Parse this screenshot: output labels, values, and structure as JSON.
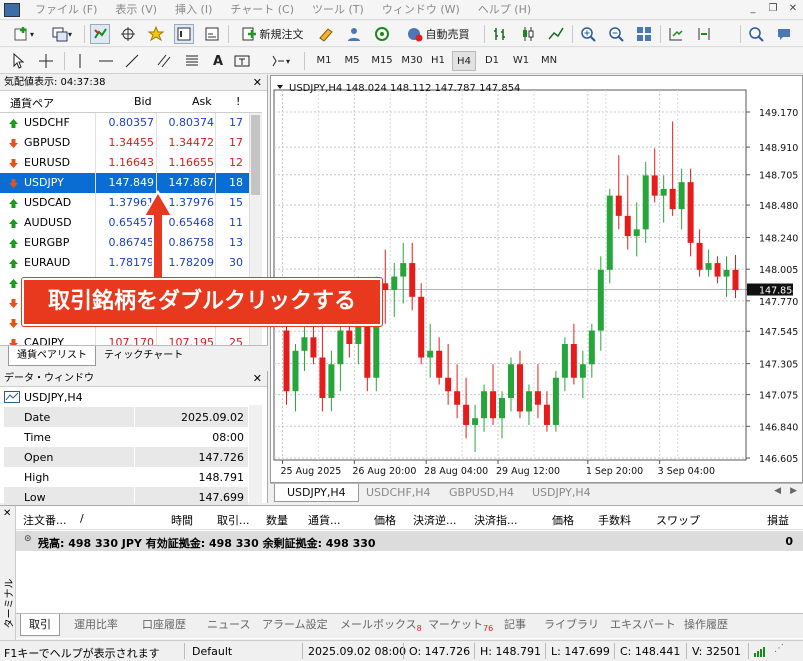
{
  "menu": {
    "items": [
      "ファイル (F)",
      "表示 (V)",
      "挿入 (I)",
      "チャート (C)",
      "ツール (T)",
      "ウィンドウ (W)",
      "ヘルプ (H)"
    ]
  },
  "toolbar": {
    "new_order": "新規注文",
    "auto_trading": "自動売買",
    "timeframes": [
      "M1",
      "M5",
      "M15",
      "M30",
      "H1",
      "H4",
      "D1",
      "W1",
      "MN"
    ],
    "active_timeframe": "H4"
  },
  "market_watch": {
    "title": "気配値表示: 04:37:38",
    "headers": {
      "symbol": "通貨ペア",
      "bid": "Bid",
      "ask": "Ask",
      "spread": "!"
    },
    "rows": [
      {
        "symbol": "USDCHF",
        "bid": "0.80357",
        "ask": "0.80374",
        "spread": "17",
        "dir": "up"
      },
      {
        "symbol": "GBPUSD",
        "bid": "1.34455",
        "ask": "1.34472",
        "spread": "17",
        "dir": "down"
      },
      {
        "symbol": "EURUSD",
        "bid": "1.16643",
        "ask": "1.16655",
        "spread": "12",
        "dir": "down"
      },
      {
        "symbol": "USDJPY",
        "bid": "147.849",
        "ask": "147.867",
        "spread": "18",
        "dir": "down",
        "selected": true
      },
      {
        "symbol": "USDCAD",
        "bid": "1.37961",
        "ask": "1.37976",
        "spread": "15",
        "dir": "up"
      },
      {
        "symbol": "AUDUSD",
        "bid": "0.65457",
        "ask": "0.65468",
        "spread": "11",
        "dir": "up"
      },
      {
        "symbol": "EURGBP",
        "bid": "0.86745",
        "ask": "0.86758",
        "spread": "13",
        "dir": "up"
      },
      {
        "symbol": "EURAUD",
        "bid": "1.78179",
        "ask": "1.78209",
        "spread": "30",
        "dir": "up"
      },
      {
        "symbol": "",
        "bid": "",
        "ask": "",
        "spread": "",
        "dir": "up"
      },
      {
        "symbol": "",
        "bid": "",
        "ask": "",
        "spread": "",
        "dir": "down"
      },
      {
        "symbol": "",
        "bid": "",
        "ask": "",
        "spread": "",
        "dir": "down"
      },
      {
        "symbol": "CADJPY",
        "bid": "107.170",
        "ask": "107.195",
        "spread": "25",
        "dir": "down"
      }
    ],
    "tabs": [
      "通貨ペアリスト",
      "ティックチャート"
    ]
  },
  "callout": {
    "text": "取引銘柄をダブルクリックする"
  },
  "data_window": {
    "title": "データ・ウィンドウ",
    "symbol": "USDJPY,H4",
    "rows": [
      {
        "label": "Date",
        "value": "2025.09.02"
      },
      {
        "label": "Time",
        "value": "08:00"
      },
      {
        "label": "Open",
        "value": "147.726"
      },
      {
        "label": "High",
        "value": "148.791"
      },
      {
        "label": "Low",
        "value": "147.699"
      }
    ]
  },
  "chart": {
    "header": "USDJPY,H4  148.024 148.112 147.787 147.854",
    "current_price": "147.854",
    "tabs": [
      "USDJPY,H4",
      "USDCHF,H4",
      "GBPUSD,H4",
      "USDJPY,H4"
    ]
  },
  "chart_data": {
    "type": "candlestick",
    "title": "USDJPY,H4",
    "ylim": [
      146.605,
      149.17
    ],
    "y_ticks": [
      "149.170",
      "148.910",
      "148.705",
      "148.480",
      "148.240",
      "148.005",
      "147.854",
      "147.770",
      "147.545",
      "147.305",
      "147.075",
      "146.840",
      "146.605"
    ],
    "x_ticks": [
      "25 Aug 2025",
      "26 Aug 20:00",
      "28 Aug 04:00",
      "29 Aug 12:00",
      "1 Sep 20:00",
      "3 Sep 04:00"
    ],
    "colors": {
      "up": "#26a63a",
      "down": "#e81b1b"
    },
    "candles": [
      {
        "o": 147.55,
        "h": 147.8,
        "l": 147.0,
        "c": 147.1
      },
      {
        "o": 147.1,
        "h": 147.45,
        "l": 146.95,
        "c": 147.4
      },
      {
        "o": 147.4,
        "h": 147.6,
        "l": 147.25,
        "c": 147.5
      },
      {
        "o": 147.5,
        "h": 147.75,
        "l": 147.3,
        "c": 147.35
      },
      {
        "o": 147.35,
        "h": 147.6,
        "l": 146.95,
        "c": 147.05
      },
      {
        "o": 147.05,
        "h": 147.4,
        "l": 146.95,
        "c": 147.3
      },
      {
        "o": 147.3,
        "h": 147.65,
        "l": 147.1,
        "c": 147.55
      },
      {
        "o": 147.55,
        "h": 147.8,
        "l": 147.35,
        "c": 147.45
      },
      {
        "o": 147.45,
        "h": 147.95,
        "l": 147.3,
        "c": 147.8
      },
      {
        "o": 147.8,
        "h": 147.9,
        "l": 147.1,
        "c": 147.2
      },
      {
        "o": 147.2,
        "h": 147.95,
        "l": 147.1,
        "c": 147.9
      },
      {
        "o": 147.9,
        "h": 148.15,
        "l": 147.6,
        "c": 147.85
      },
      {
        "o": 147.85,
        "h": 148.05,
        "l": 147.65,
        "c": 147.95
      },
      {
        "o": 147.95,
        "h": 148.2,
        "l": 147.75,
        "c": 148.05
      },
      {
        "o": 148.05,
        "h": 148.2,
        "l": 147.7,
        "c": 147.8
      },
      {
        "o": 147.8,
        "h": 147.9,
        "l": 147.3,
        "c": 147.35
      },
      {
        "o": 147.35,
        "h": 147.6,
        "l": 147.2,
        "c": 147.4
      },
      {
        "o": 147.4,
        "h": 147.5,
        "l": 147.15,
        "c": 147.2
      },
      {
        "o": 147.2,
        "h": 147.45,
        "l": 147.0,
        "c": 147.1
      },
      {
        "o": 147.1,
        "h": 147.3,
        "l": 146.9,
        "c": 147.0
      },
      {
        "o": 147.0,
        "h": 147.2,
        "l": 146.75,
        "c": 146.85
      },
      {
        "o": 146.85,
        "h": 147.0,
        "l": 146.65,
        "c": 146.9
      },
      {
        "o": 146.9,
        "h": 147.15,
        "l": 146.8,
        "c": 147.1
      },
      {
        "o": 147.1,
        "h": 147.3,
        "l": 146.85,
        "c": 146.9
      },
      {
        "o": 146.9,
        "h": 147.1,
        "l": 146.75,
        "c": 147.05
      },
      {
        "o": 147.05,
        "h": 147.35,
        "l": 146.95,
        "c": 147.3
      },
      {
        "o": 147.3,
        "h": 147.4,
        "l": 146.9,
        "c": 146.95
      },
      {
        "o": 146.95,
        "h": 147.15,
        "l": 146.85,
        "c": 147.1
      },
      {
        "o": 147.1,
        "h": 147.3,
        "l": 146.9,
        "c": 147.0
      },
      {
        "o": 147.0,
        "h": 147.1,
        "l": 146.8,
        "c": 146.85
      },
      {
        "o": 146.85,
        "h": 147.25,
        "l": 146.8,
        "c": 147.2
      },
      {
        "o": 147.2,
        "h": 147.5,
        "l": 147.1,
        "c": 147.45
      },
      {
        "o": 147.45,
        "h": 147.6,
        "l": 147.15,
        "c": 147.2
      },
      {
        "o": 147.2,
        "h": 147.4,
        "l": 147.05,
        "c": 147.3
      },
      {
        "o": 147.3,
        "h": 147.6,
        "l": 147.2,
        "c": 147.55
      },
      {
        "o": 147.55,
        "h": 148.1,
        "l": 147.4,
        "c": 148.0
      },
      {
        "o": 148.0,
        "h": 148.6,
        "l": 147.9,
        "c": 148.55
      },
      {
        "o": 148.55,
        "h": 148.85,
        "l": 148.3,
        "c": 148.4
      },
      {
        "o": 148.4,
        "h": 148.7,
        "l": 148.15,
        "c": 148.25
      },
      {
        "o": 148.25,
        "h": 148.5,
        "l": 148.1,
        "c": 148.3
      },
      {
        "o": 148.3,
        "h": 148.8,
        "l": 148.2,
        "c": 148.7
      },
      {
        "o": 148.7,
        "h": 148.9,
        "l": 148.5,
        "c": 148.55
      },
      {
        "o": 148.55,
        "h": 148.7,
        "l": 148.35,
        "c": 148.6
      },
      {
        "o": 148.6,
        "h": 149.1,
        "l": 148.4,
        "c": 148.45
      },
      {
        "o": 148.45,
        "h": 148.75,
        "l": 148.3,
        "c": 148.65
      },
      {
        "o": 148.65,
        "h": 148.75,
        "l": 148.1,
        "c": 148.2
      },
      {
        "o": 148.2,
        "h": 148.3,
        "l": 147.95,
        "c": 148.0
      },
      {
        "o": 148.0,
        "h": 148.15,
        "l": 147.95,
        "c": 148.05
      },
      {
        "o": 148.05,
        "h": 148.1,
        "l": 147.9,
        "c": 147.95
      },
      {
        "o": 147.95,
        "h": 148.1,
        "l": 147.8,
        "c": 148.0
      },
      {
        "o": 148.0,
        "h": 148.11,
        "l": 147.79,
        "c": 147.85
      }
    ]
  },
  "terminal": {
    "side_label": "ターミナル",
    "headers": [
      "注文番...",
      "/",
      "時間",
      "取引...",
      "数量",
      "通貨...",
      "価格",
      "決済逆...",
      "決済指...",
      "価格",
      "手数料",
      "スワップ",
      "損益"
    ],
    "balance_text": "残高: 498 330 JPY  有効証拠金: 498 330  余剰証拠金: 498 330",
    "balance_pl": "0",
    "tabs": [
      "取引",
      "運用比率",
      "口座履歴",
      "ニュース",
      "アラーム設定",
      "メールボックス",
      "マーケット",
      "記事",
      "ライブラリ",
      "エキスパート",
      "操作履歴"
    ],
    "mail_badge": "8",
    "market_badge": "76"
  },
  "status": {
    "help": "F1キーでヘルプが表示されます",
    "profile": "Default",
    "datetime": "2025.09.02 08:00",
    "open": "O: 147.726",
    "high": "H: 148.791",
    "low": "L: 147.699",
    "close": "C: 148.441",
    "volume": "V: 32501"
  }
}
